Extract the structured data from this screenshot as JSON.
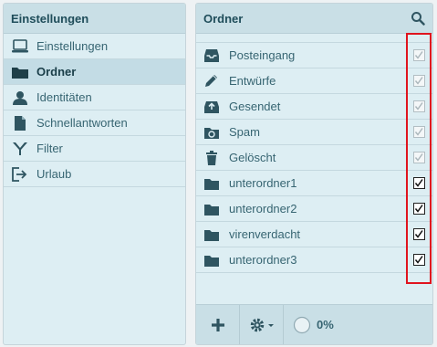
{
  "left_panel": {
    "title": "Einstellungen",
    "items": [
      {
        "label": "Einstellungen",
        "icon": "laptop-icon"
      },
      {
        "label": "Ordner",
        "icon": "folder-icon",
        "selected": true
      },
      {
        "label": "Identitäten",
        "icon": "person-icon"
      },
      {
        "label": "Schnellantworten",
        "icon": "document-icon"
      },
      {
        "label": "Filter",
        "icon": "filter-icon"
      },
      {
        "label": "Urlaub",
        "icon": "exit-arrow-icon"
      }
    ]
  },
  "right_panel": {
    "title": "Ordner",
    "folders": [
      {
        "label": "Posteingang",
        "icon": "inbox-icon",
        "subscribed": true,
        "locked": true
      },
      {
        "label": "Entwürfe",
        "icon": "pencil-icon",
        "subscribed": true,
        "locked": true
      },
      {
        "label": "Gesendet",
        "icon": "sent-icon",
        "subscribed": true,
        "locked": true
      },
      {
        "label": "Spam",
        "icon": "recycle-folder-icon",
        "subscribed": true,
        "locked": true
      },
      {
        "label": "Gelöscht",
        "icon": "trash-icon",
        "subscribed": true,
        "locked": true
      },
      {
        "label": "unterordner1",
        "icon": "folder-icon",
        "subscribed": true,
        "locked": false
      },
      {
        "label": "unterordner2",
        "icon": "folder-icon",
        "subscribed": true,
        "locked": false
      },
      {
        "label": "virenverdacht",
        "icon": "folder-icon",
        "subscribed": true,
        "locked": false
      },
      {
        "label": "unterordner3",
        "icon": "folder-icon",
        "subscribed": true,
        "locked": false
      }
    ],
    "quota": "0%"
  },
  "colors": {
    "highlight": "#e0141e",
    "icon": "#2f5561",
    "header_bg": "#c9dfe6",
    "panel_bg": "#ddeef3"
  }
}
